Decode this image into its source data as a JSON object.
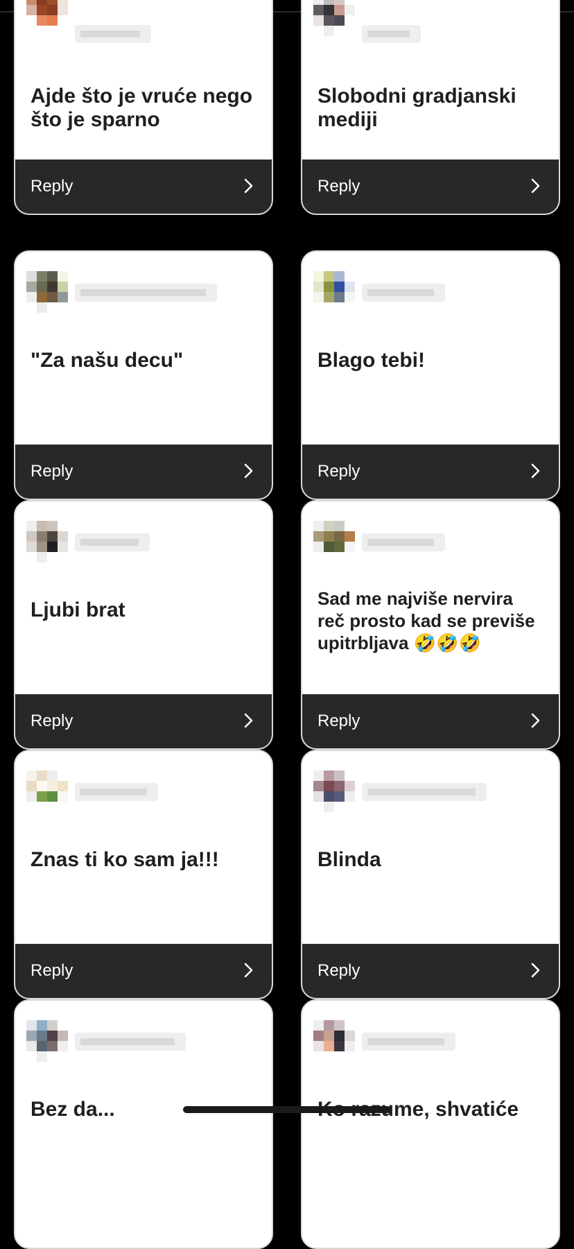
{
  "cards": [
    {
      "question": "Ajde što je vruće nego\nšto je sparno",
      "reply_label": "Reply"
    },
    {
      "question": "Slobodni gradjanski\nmediji",
      "reply_label": "Reply"
    },
    {
      "question": "\"Za našu decu\"",
      "reply_label": "Reply"
    },
    {
      "question": "Blago tebi!",
      "reply_label": "Reply"
    },
    {
      "question": "Ljubi brat",
      "reply_label": "Reply"
    },
    {
      "question": "Sad me najviše nervira\nreč prosto kad se previše\nupitrbljava 🤣🤣🤣",
      "reply_label": "Reply"
    },
    {
      "question": "Znas ti ko sam ja!!!",
      "reply_label": "Reply"
    },
    {
      "question": "Blinda",
      "reply_label": "Reply"
    },
    {
      "question": "Bez da...",
      "reply_label": ""
    },
    {
      "question": "Ko razume, shvatiće",
      "reply_label": ""
    }
  ],
  "icons": {
    "reply_chevron": "chevron-right-icon"
  },
  "colors": {
    "background": "#000000",
    "card": "#ffffff",
    "reply_bar": "#282828"
  }
}
